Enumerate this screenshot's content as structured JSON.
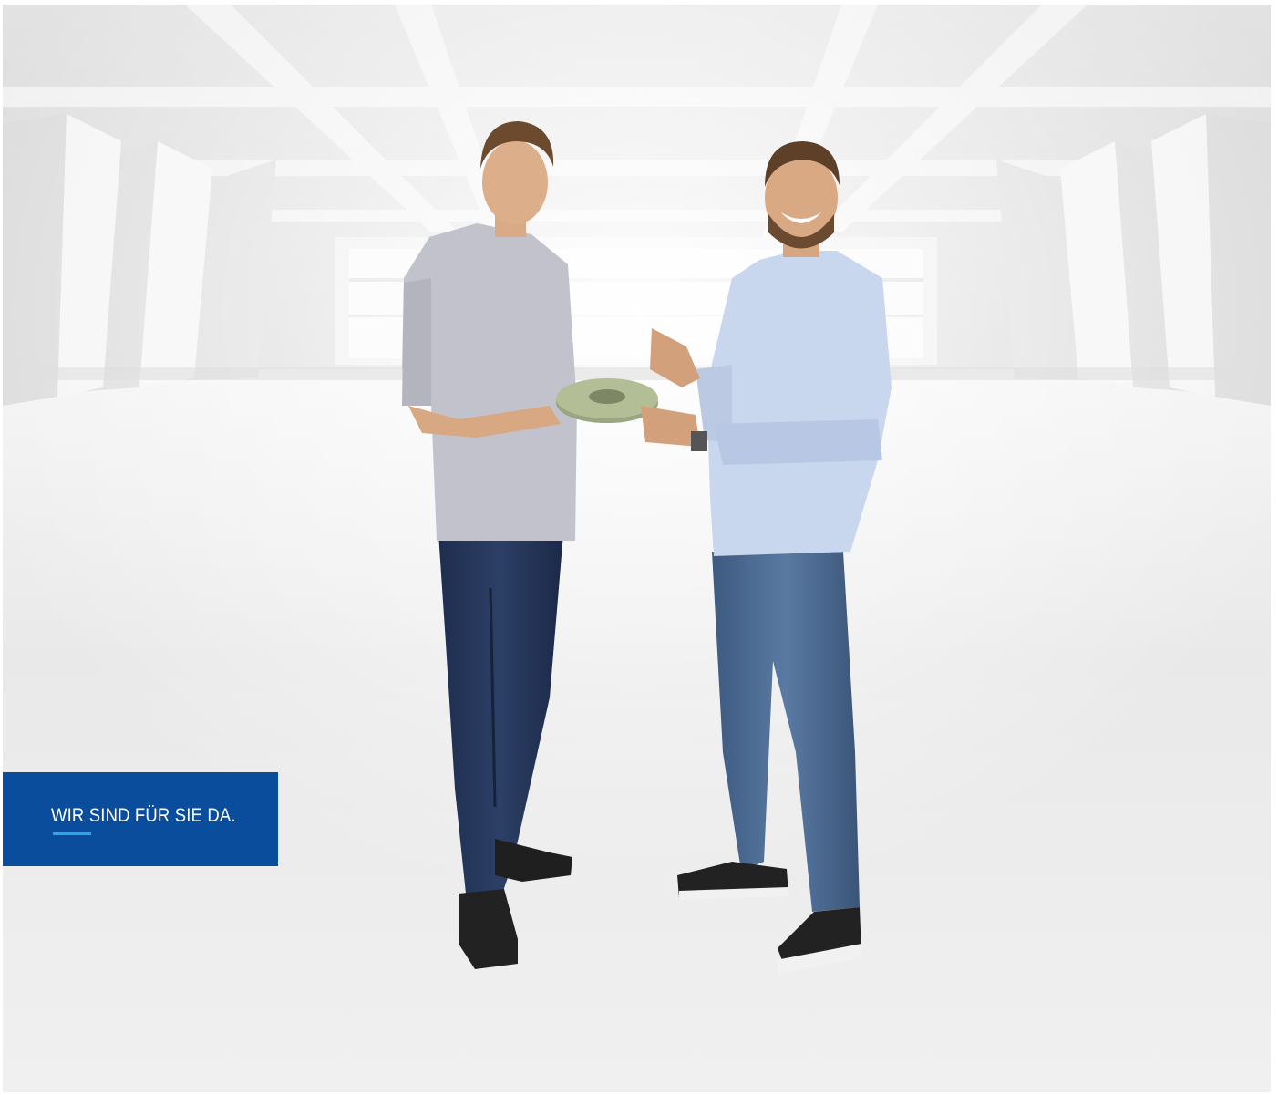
{
  "cta": {
    "label": "WIR SIND FÜR SIE DA.",
    "background_color": "#0a4d9c",
    "accent_color": "#2ea3e6",
    "text_color": "#ffffff"
  },
  "scene": {
    "background_icon": "warehouse-hall-illustration",
    "subjects_icon": "two-men-holding-part-illustration"
  }
}
